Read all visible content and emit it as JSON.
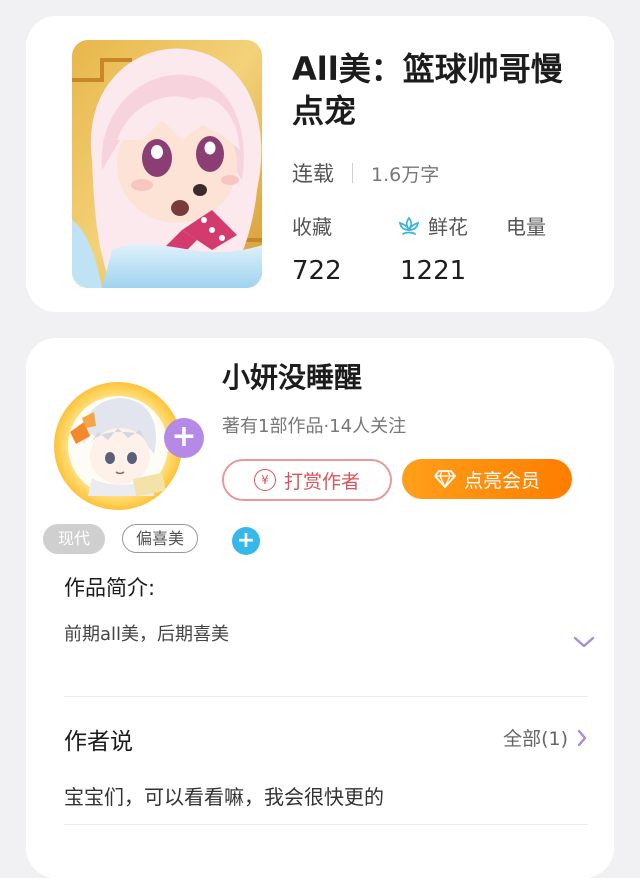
{
  "book": {
    "title": "All美：篮球帅哥慢点宠",
    "status": "连载",
    "word_count": "1.6万字",
    "stats": {
      "favorites_label": "收藏",
      "favorites_value": "722",
      "flowers_label": "鲜花",
      "flowers_value": "1221",
      "power_label": "电量"
    }
  },
  "author": {
    "name": "小妍没睡醒",
    "meta": "著有1部作品·14人关注",
    "reward_label": "打赏作者",
    "reward_icon_glyph": "¥",
    "vip_label": "点亮会员",
    "tags": [
      "现代",
      "偏喜美"
    ],
    "add_tag_glyph": "+",
    "follow_glyph": "+"
  },
  "intro": {
    "heading": "作品简介:",
    "text": "前期all美，后期喜美"
  },
  "author_says": {
    "heading": "作者说",
    "all_link": "全部(1)",
    "text": "宝宝们，可以看看嘛，我会很快更的"
  },
  "colors": {
    "page_bg": "#f1f1f3",
    "vip_orange": "#ff8a0d",
    "reward_red": "#d9555b",
    "accent_purple": "#b58ae6",
    "add_blue": "#36b9ea",
    "flower_teal": "#3bb6d6"
  },
  "icons": {
    "flower": "flower-icon",
    "coin": "yuan-coin-icon",
    "diamond": "diamond-icon",
    "expand": "chevron-down-icon",
    "more": "chevron-right-icon"
  }
}
